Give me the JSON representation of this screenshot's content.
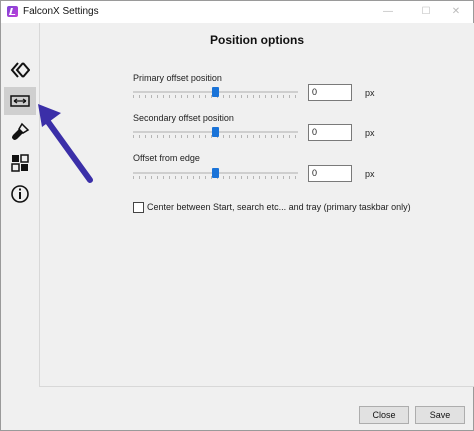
{
  "window": {
    "title": "FalconX Settings",
    "controls": {
      "minimize": "—",
      "maximize": "☐",
      "close": "✕"
    }
  },
  "sidebar": {
    "items": [
      {
        "icon": "falconx-logo-icon",
        "active": false
      },
      {
        "icon": "position-icon",
        "active": true
      },
      {
        "icon": "brush-icon",
        "active": false
      },
      {
        "icon": "grid-icon",
        "active": false
      },
      {
        "icon": "info-icon",
        "active": false
      }
    ]
  },
  "main": {
    "title": "Position options",
    "fields": [
      {
        "label": "Primary offset position",
        "value": "0",
        "unit": "px",
        "slider_fraction": 0.5
      },
      {
        "label": "Secondary offset position",
        "value": "0",
        "unit": "px",
        "slider_fraction": 0.5
      },
      {
        "label": "Offset from edge",
        "value": "0",
        "unit": "px",
        "slider_fraction": 0.5
      }
    ],
    "center_checkbox": {
      "label": "Center between Start, search etc... and tray (primary taskbar only)",
      "checked": false
    }
  },
  "footer": {
    "close_label": "Close",
    "save_label": "Save"
  },
  "colors": {
    "accent": "#1a73d8",
    "annotation_arrow": "#3b2fa8",
    "active_tab": "#cfcfcf"
  }
}
